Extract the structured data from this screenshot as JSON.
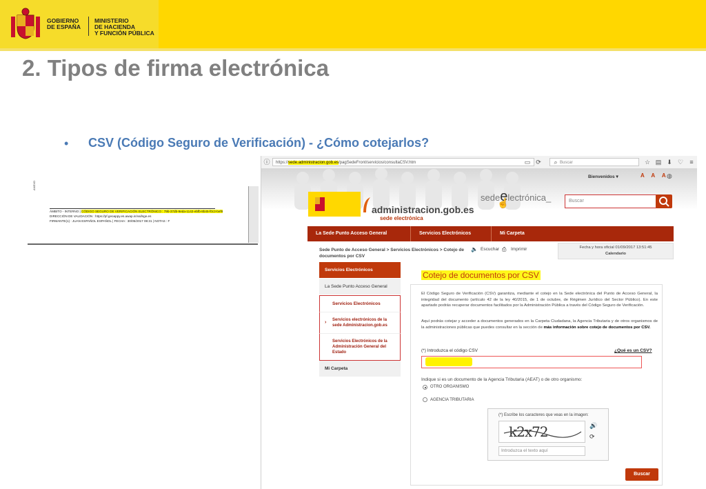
{
  "header": {
    "gov_line1": "GOBIERNO",
    "gov_line2": "DE ESPAÑA",
    "min_line1": "MINISTERIO",
    "min_line2": "DE HACIENDA",
    "min_line3": "Y FUNCIÓN PÚBLICA"
  },
  "slide": {
    "title": "2. Tipos de firma electrónica",
    "bullet": "•",
    "subtitle": "CSV (Código Seguro de Verificación) - ¿Cómo cotejarlos?"
  },
  "doc_snippet": {
    "side_label": "ANEXO",
    "line1_prefix": "ÁMBITO - INTERNO | ",
    "line1_highlight": "CÓDIGO SEGURO DE VERIFICACIÓN ELECTRÓNICO : 79b-37db-9eda-1142-ebfb-8b45-f0c3-bef9",
    "line2": "DIRECCIÓN DE VALIDACIÓN : https://pf.geoappy.es.awap.in/val/sge.es",
    "line3": "FIRMANTE(1) : JUAN ESPAÑOL ESPAÑOL | FECHA : 30/05/2017 08:31 | NOTAS : F"
  },
  "browser": {
    "url_prefix": "https://",
    "url_host": "sede.administracion.gob.es",
    "url_path": "/pagSedeFront/servicios/consultaCSV.htm",
    "search_placeholder": "Buscar"
  },
  "site": {
    "welcome": "Bienvenidos ▾",
    "font_sizes": "A A A",
    "lang_icon": "globe-icon",
    "brand_e": "sede",
    "brand_e2": "lectrónica_",
    "brand_name": "administracion.gob.es",
    "brand_sub": "sede electrónica",
    "search_placeholder": "Buscar",
    "nav": [
      "La Sede Punto Acceso General",
      "Servicios Electrónicos",
      "Mi Carpeta"
    ],
    "breadcrumb": "Sede Punto de Acceso General  >  Servicios Electrónicos  >  Cotejo de documentos por CSV",
    "listen": "Escuchar",
    "print": "Imprimir",
    "clock_line1": "Fecha y hora oficial 01/09/2017 13:51:45",
    "clock_line2": "Calendario",
    "sidebar": {
      "head": "Servicios Electrónicos",
      "item1": "La Sede Punto Acceso General",
      "item2": "Servicios Electrónicos",
      "sub1": "Servicios electrónicos de la sede Administracion.gob.es",
      "sub2": "Servicios Electrónicos de la Administración General del Estado",
      "item3": "Mi Carpeta"
    },
    "content_title": "Cotejo de documentos por CSV",
    "para1": "El Código Seguro de Verificación (CSV) garantiza, mediante el cotejo en la Sede electrónica del Punto de Acceso General, la integridad del documento (artículo 42 de la ley 40/2015, de 1 de octubre, de Régimen Jurídico del Sector Público). En este apartado podrás recuperar documentos facilitados por la Administración Pública a través del Código Seguro de Verificación.",
    "para2": "Aquí podrás cotejar y acceder a documentos generados en la Carpeta Ciudadana, la Agencia Tributaria y de otros organismos de la administraciones públicas que puedes consultar en la sección de",
    "para2_bold": "más información sobre cotejo de documentos por CSV.",
    "csv_label": "(*) Introduzca el código CSV",
    "csv_link": "¿Qué es un CSV?",
    "org_question": "Indique si es un documento de la Agencia Tributaria (AEAT) o de otro organismo:",
    "radio1": "OTRO ORGANISMO",
    "radio2": "AGENCIA TRIBUTARIA",
    "captcha_label": "(*) Escribe los caracteres que veas en la imagen:",
    "captcha_text": "k2x72",
    "captcha_placeholder": "Introduzca el texto aquí",
    "submit": "Buscar"
  }
}
